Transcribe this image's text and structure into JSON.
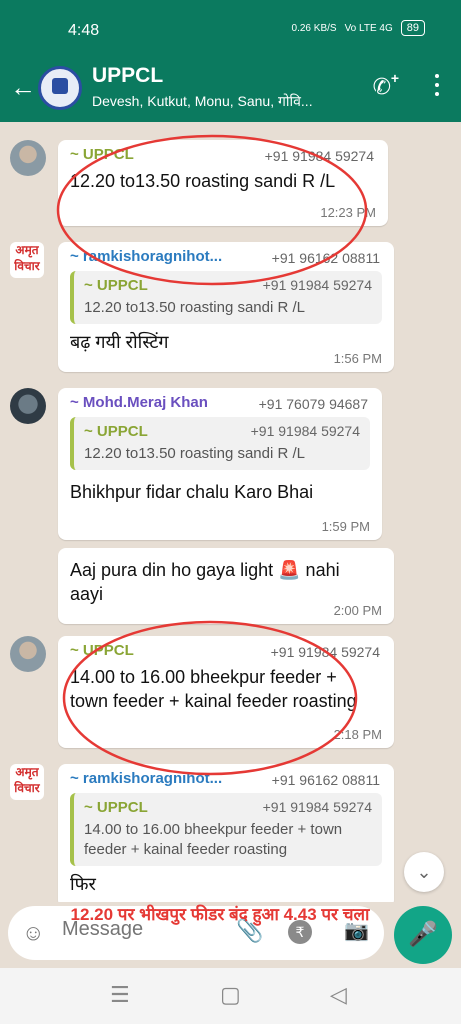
{
  "status": {
    "time": "4:48",
    "net_speed": "0.26 KB/S",
    "signal": "Vo LTE 4G",
    "battery": "89"
  },
  "header": {
    "title": "UPPCL",
    "subtitle": "Devesh, Kutkut, Monu, Sanu, गोवि..."
  },
  "messages": [
    {
      "sender": "~ UPPCL",
      "phone": "+91 91984 59274",
      "text": "12.20 to13.50 roasting sandi R /L",
      "time": "12:23 PM"
    },
    {
      "sender": "~ ramkishoragnihot...",
      "phone": "+91 96162 08811",
      "quote_sender": "~ UPPCL",
      "quote_phone": "+91 91984 59274",
      "quote_text": "12.20 to13.50 roasting sandi R /L",
      "text": "बढ़  गयी रोस्टिंग",
      "time": "1:56 PM"
    },
    {
      "sender": "~ Mohd.Meraj Khan",
      "phone": "+91 76079 94687",
      "quote_sender": "~ UPPCL",
      "quote_phone": "+91 91984 59274",
      "quote_text": "12.20 to13.50 roasting sandi R /L",
      "text": "Bhikhpur fidar chalu Karo Bhai",
      "time": "1:59 PM"
    },
    {
      "text": "Aaj pura din ho gaya light 🚨 nahi aayi",
      "time": "2:00 PM"
    },
    {
      "sender": "~ UPPCL",
      "phone": "+91 91984 59274",
      "text": "14.00 to 16.00 bheekpur feeder + town feeder + kainal feeder roasting",
      "time": "2:18 PM"
    },
    {
      "sender": "~ ramkishoragnihot...",
      "phone": "+91 96162 08811",
      "quote_sender": "~ UPPCL",
      "quote_phone": "+91 91984 59274",
      "quote_text": "14.00 to 16.00 bheekpur feeder + town feeder + kainal feeder roasting",
      "text": "फिर",
      "time": ""
    }
  ],
  "avatar_amrit": "अमृत विचार",
  "composer": {
    "placeholder": "Message",
    "rupee": "₹"
  },
  "overlay_caption": "12.20 पर भीखपुर फीडर बंद हुआ 4.43 पर चला",
  "colors": {
    "header": "#0b7a5f",
    "mic": "#12a587",
    "annotation": "#e53935"
  }
}
